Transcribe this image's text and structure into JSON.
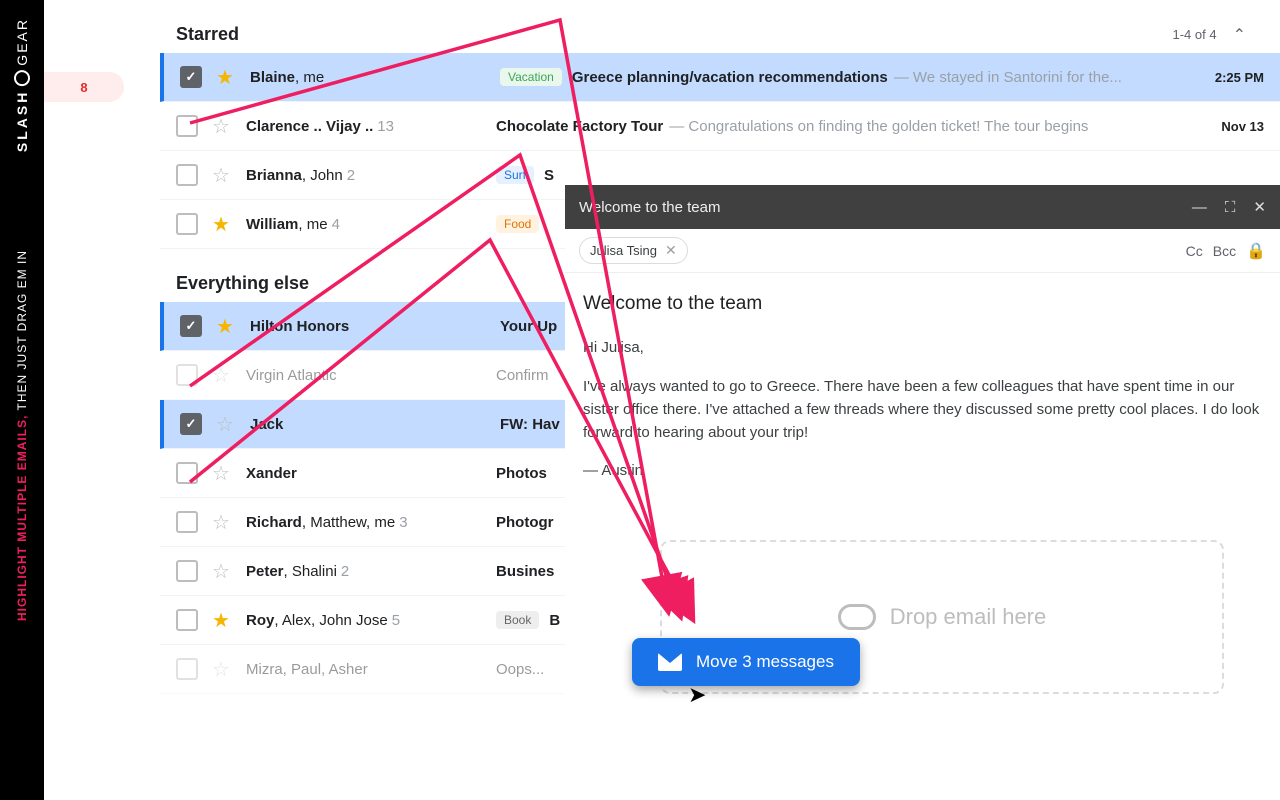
{
  "brand": {
    "l1": "SLASH",
    "l2": "GEAR"
  },
  "caption": {
    "pink": "HIGHLIGHT MULTIPLE EMAILS,",
    "white": " THEN JUST DRAG EM IN"
  },
  "badge": "8",
  "sections": {
    "starred": {
      "title": "Starred",
      "count": "1-4 of 4"
    },
    "else": {
      "title": "Everything else"
    }
  },
  "rows": {
    "r1": {
      "sender": "Blaine",
      "senderSuffix": ", me",
      "label": "Vacation",
      "subject": "Greece planning/vacation recommendations",
      "snippet": " — We stayed in Santorini for the...",
      "time": "2:25 PM"
    },
    "r2": {
      "sender": "Clarence .. Vijay ..",
      "num": "13",
      "subject": "Chocolate Factory Tour",
      "snippet": " — Congratulations on finding the golden ticket! The tour begins",
      "time": "Nov 13"
    },
    "r3": {
      "sender": "Brianna",
      "senderSuffix": ", John",
      "num": "2",
      "label": "Surf",
      "subject": "S"
    },
    "r4": {
      "sender": "William",
      "senderSuffix": ", me",
      "num": "4",
      "label": "Food"
    },
    "e1": {
      "sender": "Hilton Honors",
      "subject": "Your Up"
    },
    "e2": {
      "sender": "Virgin Atlantic",
      "subject": "Confirm"
    },
    "e3": {
      "sender": "Jack",
      "subject": "FW: Hav"
    },
    "e4": {
      "sender": "Xander",
      "subject": "Photos "
    },
    "e5": {
      "sender": "Richard",
      "senderSuffix": ", Matthew, me",
      "num": "3",
      "subject": "Photogr"
    },
    "e6": {
      "sender": "Peter",
      "senderSuffix": ", Shalini",
      "num": "2",
      "subject": "Busines"
    },
    "e7": {
      "sender": "Roy",
      "senderSuffix": ", Alex, John Jose",
      "num": "5",
      "label": "Book",
      "subject": "B"
    },
    "e8": {
      "sender": "Mizra",
      "senderSuffix": ", Paul, Asher",
      "subject": "Oops..."
    }
  },
  "compose": {
    "title": "Welcome to the team",
    "recipient": "Julisa Tsing",
    "cc": "Cc",
    "bcc": "Bcc",
    "bodyTitle": "Welcome to the team",
    "greeting": "Hi Julisa,",
    "para": "I've always wanted to go to Greece. There have been a few colleagues that have spent time in our sister office there. I've attached a few threads where they discussed some pretty cool places. I do look forward to hearing about your trip!",
    "sig": "— Austin"
  },
  "drop": {
    "text": "Drop email here"
  },
  "move": {
    "label": "Move 3 messages"
  }
}
